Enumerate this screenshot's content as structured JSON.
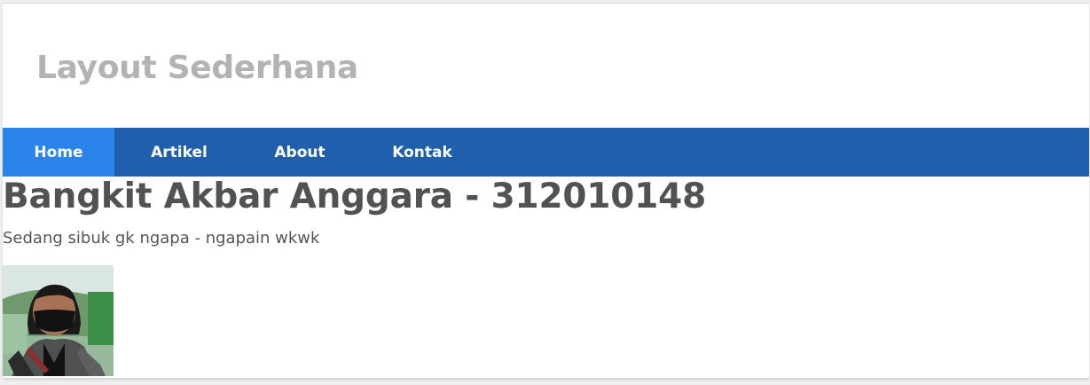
{
  "header": {
    "title": "Layout Sederhana"
  },
  "nav": {
    "items": [
      {
        "label": "Home",
        "active": true
      },
      {
        "label": "Artikel",
        "active": false
      },
      {
        "label": "About",
        "active": false
      },
      {
        "label": "Kontak",
        "active": false
      }
    ]
  },
  "profile": {
    "name": "Bangkit Akbar Anggara - 312010148",
    "status": "Sedang sibuk gk ngapa - ngapain wkwk"
  },
  "colors": {
    "nav_background": "#1f5fac",
    "nav_active": "#2b84ea",
    "title_text": "#b3b3b3",
    "body_text": "#525252"
  }
}
